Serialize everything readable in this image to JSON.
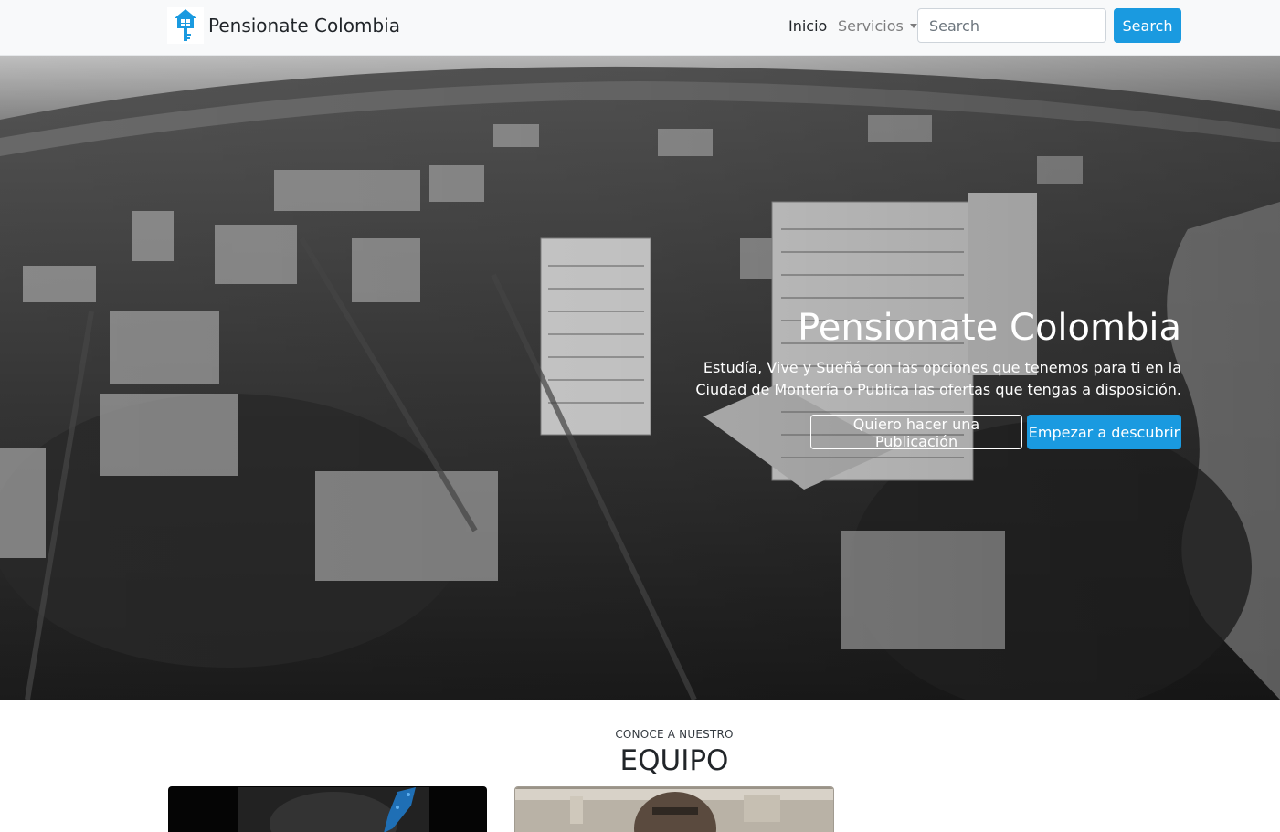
{
  "navbar": {
    "brand_name": "Pensionate Colombia",
    "logo_icon": "house-key-icon",
    "links": {
      "inicio": "Inicio",
      "servicios": "Servicios"
    },
    "search": {
      "placeholder": "Search",
      "button_label": "Search"
    }
  },
  "hero": {
    "title": "Pensionate Colombia",
    "text": "Estudía, Vive y Sueñá con las opciones que tenemos para ti en la Ciudad de Montería o Publica las ofertas que tengas a disposición.",
    "buttons": {
      "publish": "Quiero hacer una Publicación",
      "discover": "Empezar a descubrir"
    }
  },
  "team": {
    "kicker": "CONOCE A NUESTRO",
    "heading": "EQUIPO"
  },
  "colors": {
    "accent": "#1a9ae0",
    "navbar_bg": "#f8f9fa"
  }
}
